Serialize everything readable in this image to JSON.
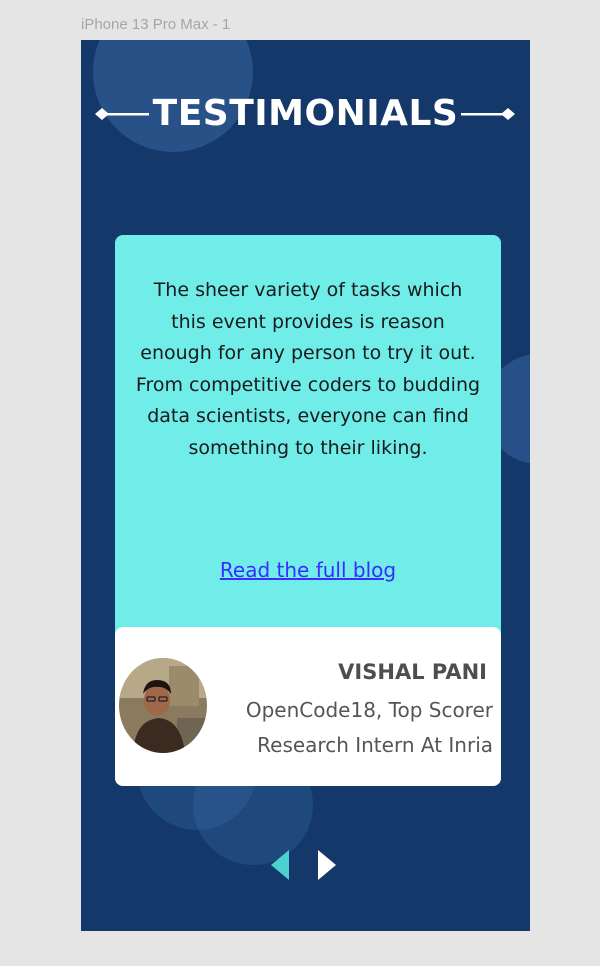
{
  "frame": {
    "label": "iPhone 13 Pro Max - 1"
  },
  "header": {
    "title": "TESTIMONIALS"
  },
  "testimonial": {
    "quote": "The sheer variety of tasks which this event provides is reason enough for any person to try it out. From competitive coders to budding data scientists, everyone can find something to their liking.",
    "link_label": "Read the full blog",
    "author": {
      "name": "VISHAL PANI",
      "line1": "OpenCode18, Top Scorer",
      "line2": "Research Intern At Inria"
    }
  },
  "navigation": {
    "prev_icon": "triangle-left-icon",
    "next_icon": "triangle-right-icon",
    "prev_color": "#4fd0d0",
    "next_color": "#ffffff"
  },
  "colors": {
    "background": "#14386a",
    "card": "#70ece9",
    "link": "#3a2bff",
    "author_card": "#ffffff"
  }
}
